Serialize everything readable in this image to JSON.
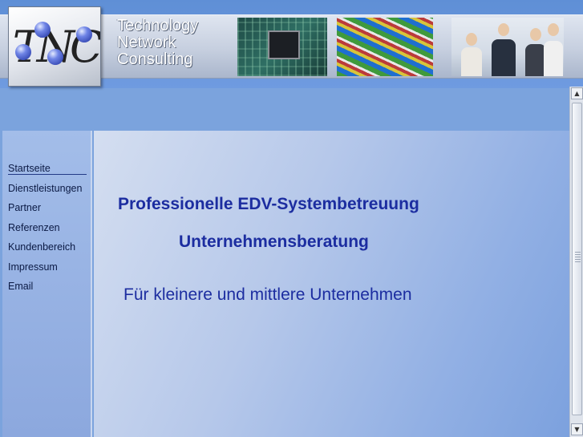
{
  "header": {
    "logo_text": "TNC",
    "company_name": [
      "Technology",
      "Network",
      "Consulting"
    ]
  },
  "nav": {
    "items": [
      {
        "label": "Startseite",
        "active": true
      },
      {
        "label": "Dienstleistungen",
        "active": false
      },
      {
        "label": "Partner",
        "active": false
      },
      {
        "label": "Referenzen",
        "active": false
      },
      {
        "label": "Kundenbereich",
        "active": false
      },
      {
        "label": "Impressum",
        "active": false
      },
      {
        "label": "Email",
        "active": false
      }
    ]
  },
  "main": {
    "headline_1": "Professionelle EDV-Systembetreuung",
    "headline_2": "Unternehmensberatung",
    "tagline": "Für kleinere und mittlere Unternehmen"
  },
  "scrollbar": {
    "up_icon": "arrow-up-icon",
    "down_icon": "arrow-down-icon"
  },
  "colors": {
    "headline": "#1c2da0",
    "nav_text": "#0b1a44",
    "background": "#7ba3dd"
  }
}
